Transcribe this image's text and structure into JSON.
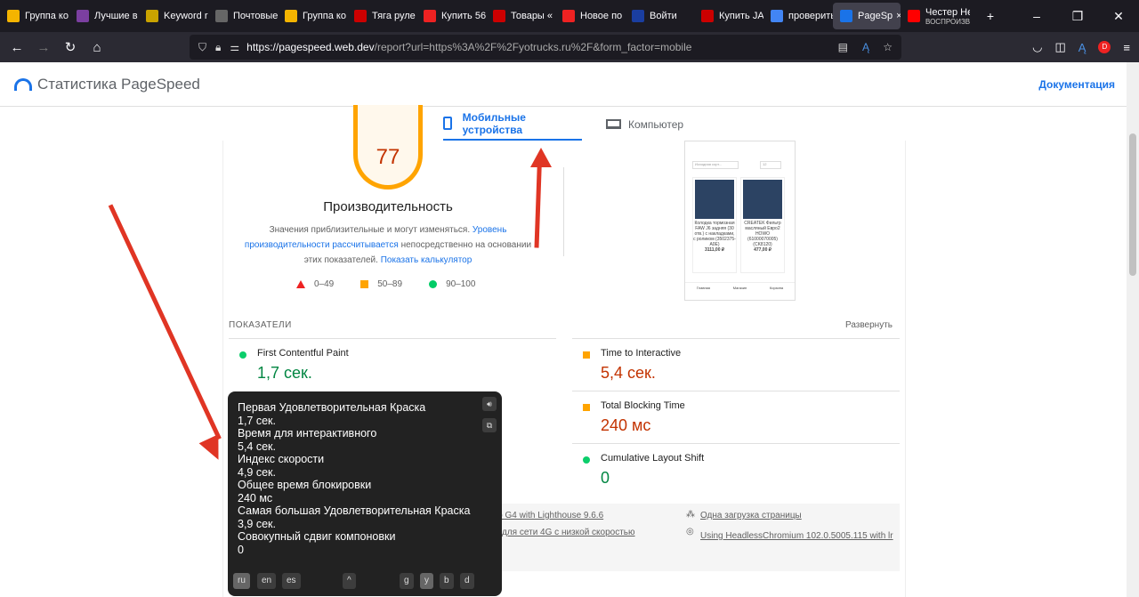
{
  "browser": {
    "tabs": [
      {
        "title": "Группа ко",
        "color": "#f4b400"
      },
      {
        "title": "Лучшие в",
        "color": "#7b3fa0"
      },
      {
        "title": "Keyword r",
        "color": "#c9a300"
      },
      {
        "title": "Почтовые",
        "color": "#666"
      },
      {
        "title": "Группа ко",
        "color": "#f4b400"
      },
      {
        "title": "Тяга руле",
        "color": "#c00"
      },
      {
        "title": "Купить 56",
        "color": "#e22"
      },
      {
        "title": "Товары «",
        "color": "#c00"
      },
      {
        "title": "Новое по",
        "color": "#e22"
      },
      {
        "title": "Войти",
        "color": "#1a3ea0"
      },
      {
        "title": "Купить JA",
        "color": "#c00"
      },
      {
        "title": "проверить",
        "color": "#4285f4"
      },
      {
        "title": "PageSp",
        "color": "#1a73e8",
        "active": true
      },
      {
        "title": "Честер Не",
        "subtitle": "ВОСПРОИЗВ",
        "color": "#f00"
      }
    ],
    "url_host": "https://pagespeed.web.dev",
    "url_rest": "/report?url=https%3A%2F%2Fyotrucks.ru%2F&form_factor=mobile"
  },
  "header": {
    "title": "Статистика PageSpeed",
    "docs": "Документация"
  },
  "device_tabs": {
    "mobile": "Мобильные устройства",
    "desktop": "Компьютер"
  },
  "score": {
    "value": "77",
    "label": "Производительность",
    "color": "#ffa400"
  },
  "description": {
    "text1": "Значения приблизительные и могут изменяться. ",
    "link1": "Уровень производительности рассчитывается",
    "text2": " непосредственно на основании этих показателей. ",
    "link2": "Показать калькулятор"
  },
  "legend": [
    "0–49",
    "50–89",
    "90–100"
  ],
  "screenshot": {
    "select1": "Исходная сорт...",
    "select2": "12",
    "products": [
      {
        "name": "Колодка тормозная FAW J6 задняя (30 отв.) с накладками, с роликом (3502375-A0E)",
        "price": "3111,00 ₽"
      },
      {
        "name": "CREATEK Фильтр масляный Евро2 HOWO (61000070005) (CK8120)",
        "price": "477,00 ₽"
      }
    ],
    "nav": [
      "Главная",
      "Магазин",
      "Корзина"
    ]
  },
  "metrics": {
    "heading": "ПОКАЗАТЕЛИ",
    "expand": "Развернуть",
    "items": [
      {
        "label": "First Contentful Paint",
        "value": "1,7 сек.",
        "status": "good"
      },
      {
        "label": "Time to Interactive",
        "value": "5,4 сек.",
        "status": "average"
      },
      {
        "label": "Total Blocking Time",
        "value": "240 мс",
        "status": "average"
      },
      {
        "label": "Cumulative Layout Shift",
        "value": "0",
        "status": "good"
      }
    ]
  },
  "info": {
    "device": "ция Moto G4 with Lighthouse 9.6.6",
    "network": "чичение для сети 4G с низкой скоростью",
    "load": "Одна загрузка страницы",
    "browser": "Using HeadlessChromium 102.0.5005.115 with lr"
  },
  "tooltip": {
    "lines": [
      "Первая Удовлетворительная Краска",
      "1,7 сек.",
      "Время для интерактивного",
      "5,4 сек.",
      "Индекс скорости",
      "4,9 сек.",
      "Общее время блокировки",
      "240 мс",
      "Самая большая Удовлетворительная Краска",
      "3,9 сек.",
      "Совокупный сдвиг компоновки",
      "0"
    ],
    "langs": [
      "ru",
      "en",
      "es"
    ],
    "engines": [
      "g",
      "y",
      "b",
      "d"
    ]
  },
  "colors": {
    "good": "#0cce6b",
    "good_text": "#018642",
    "average": "#ffa400",
    "average_text": "#c33300",
    "accent": "#1a73e8",
    "arrow": "#e03524"
  }
}
